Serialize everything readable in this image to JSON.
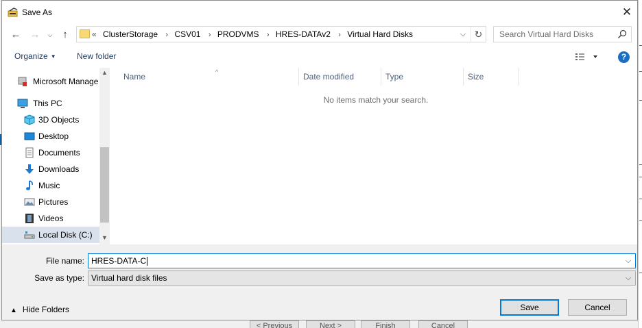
{
  "dialog": {
    "title": "Save As",
    "close_glyph": "✕"
  },
  "nav": {
    "back_glyph": "←",
    "forward_glyph": "→",
    "up_glyph": "↑",
    "breadcrumb_prefix": "«",
    "breadcrumbs": [
      "ClusterStorage",
      "CSV01",
      "PRODVMS",
      "HRES-DATAv2",
      "Virtual Hard Disks"
    ],
    "breadcrumb_separator": "›",
    "dropdown_glyph": "⌵",
    "refresh_glyph": "↻",
    "search_placeholder": "Search Virtual Hard Disks"
  },
  "toolbar": {
    "organize_label": "Organize",
    "new_folder_label": "New folder",
    "help_glyph": "?"
  },
  "sidebar": {
    "items": [
      {
        "label": "Microsoft Manage",
        "icon": "network-server-icon",
        "selected": false
      },
      {
        "label": "This PC",
        "icon": "computer-icon",
        "selected": false
      },
      {
        "label": "3D Objects",
        "icon": "3d-objects-icon",
        "selected": false
      },
      {
        "label": "Desktop",
        "icon": "desktop-icon",
        "selected": false
      },
      {
        "label": "Documents",
        "icon": "documents-icon",
        "selected": false
      },
      {
        "label": "Downloads",
        "icon": "downloads-icon",
        "selected": false
      },
      {
        "label": "Music",
        "icon": "music-icon",
        "selected": false
      },
      {
        "label": "Pictures",
        "icon": "pictures-icon",
        "selected": false
      },
      {
        "label": "Videos",
        "icon": "videos-icon",
        "selected": false
      },
      {
        "label": "Local Disk (C:)",
        "icon": "local-disk-icon",
        "selected": true
      }
    ]
  },
  "filelist": {
    "columns": [
      "Name",
      "Date modified",
      "Type",
      "Size"
    ],
    "empty_message": "No items match your search."
  },
  "form": {
    "file_name_label": "File name:",
    "file_name_value": "HRES-DATA-C",
    "save_type_label": "Save as type:",
    "save_type_value": "Virtual hard disk files",
    "hide_folders_label": "Hide Folders",
    "save_label": "Save",
    "cancel_label": "Cancel"
  },
  "background_wizard": {
    "previous_label": "< Previous",
    "next_label": "Next >",
    "finish_label": "Finish",
    "cancel_label": "Cancel"
  },
  "colors": {
    "accent": "#0078d7",
    "selection": "#d9e2ec",
    "help": "#1a6fc4"
  }
}
